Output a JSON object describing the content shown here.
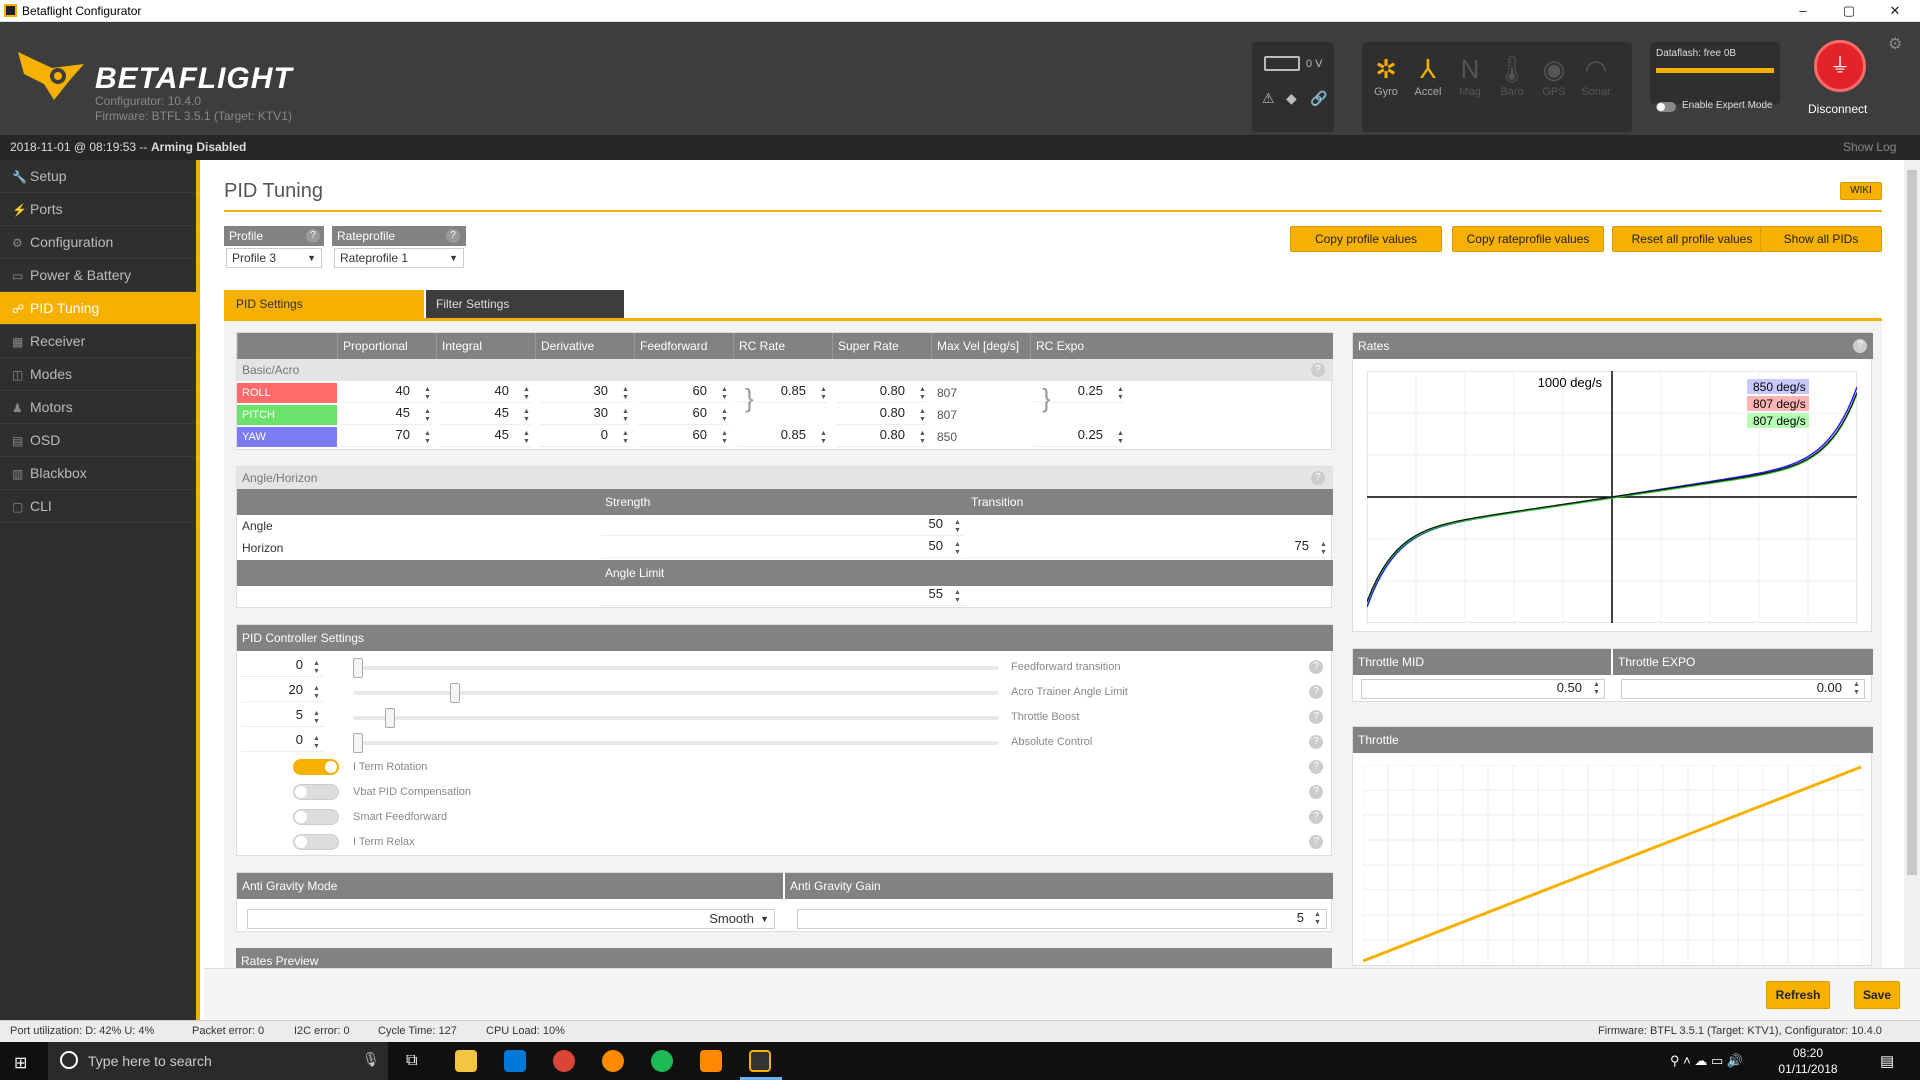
{
  "window": {
    "title": "Betaflight Configurator",
    "min": "–",
    "max": "▢",
    "close": "✕"
  },
  "header": {
    "logo_text": "BETAFLIGHT",
    "configurator_version": "Configurator: 10.4.0",
    "firmware_version": "Firmware: BTFL 3.5.1 (Target: KTV1)",
    "battery_voltage": "0 V",
    "sensors": [
      {
        "label": "Gyro",
        "active": true,
        "icon": "gyro-icon"
      },
      {
        "label": "Accel",
        "active": true,
        "icon": "accel-icon"
      },
      {
        "label": "Mag",
        "active": false,
        "icon": "mag-icon"
      },
      {
        "label": "Baro",
        "active": false,
        "icon": "baro-icon"
      },
      {
        "label": "GPS",
        "active": false,
        "icon": "gps-icon"
      },
      {
        "label": "Sonar",
        "active": false,
        "icon": "sonar-icon"
      }
    ],
    "dataflash": "Dataflash: free 0B",
    "expert_mode_label": "Enable Expert Mode",
    "disconnect_label": "Disconnect"
  },
  "statusline": {
    "datetime": "2018-11-01 @ 08:19:53 --",
    "arming": "Arming Disabled",
    "show_log": "Show Log"
  },
  "sidebar": {
    "items": [
      {
        "label": "Setup",
        "icon": "wrench-icon",
        "glyph": "🔧"
      },
      {
        "label": "Ports",
        "icon": "plug-icon",
        "glyph": "⚡"
      },
      {
        "label": "Configuration",
        "icon": "gear-icon",
        "glyph": "⚙"
      },
      {
        "label": "Power & Battery",
        "icon": "battery-icon",
        "glyph": "▭"
      },
      {
        "label": "PID Tuning",
        "icon": "pid-icon",
        "glyph": "☍",
        "active": true
      },
      {
        "label": "Receiver",
        "icon": "receiver-icon",
        "glyph": "▦"
      },
      {
        "label": "Modes",
        "icon": "modes-icon",
        "glyph": "◫"
      },
      {
        "label": "Motors",
        "icon": "motor-icon",
        "glyph": "♟"
      },
      {
        "label": "OSD",
        "icon": "osd-icon",
        "glyph": "▤"
      },
      {
        "label": "Blackbox",
        "icon": "blackbox-icon",
        "glyph": "▥"
      },
      {
        "label": "CLI",
        "icon": "cli-icon",
        "glyph": "▢"
      }
    ]
  },
  "page": {
    "title": "PID Tuning",
    "wiki": "WIKI",
    "profile_label": "Profile",
    "profile_value": "Profile 3",
    "rateprofile_label": "Rateprofile",
    "rateprofile_value": "Rateprofile 1",
    "buttons": {
      "copy_profile": "Copy profile values",
      "copy_rateprofile": "Copy rateprofile values",
      "reset_all": "Reset all profile values",
      "show_all": "Show all PIDs"
    },
    "tabs": {
      "pid": "PID Settings",
      "filter": "Filter Settings"
    }
  },
  "pid_table": {
    "headers": [
      "",
      "Proportional",
      "Integral",
      "Derivative",
      "Feedforward",
      "RC Rate",
      "Super Rate",
      "Max Vel [deg/s]",
      "RC Expo"
    ],
    "section": "Basic/Acro",
    "rows": [
      {
        "axis": "ROLL",
        "color": "#ff6b6b",
        "p": "40",
        "i": "40",
        "d": "30",
        "ff": "60",
        "rc_rate": "0.85",
        "super_rate": "0.80",
        "max_vel": "807",
        "expo": "0.25"
      },
      {
        "axis": "PITCH",
        "color": "#6be36b",
        "p": "45",
        "i": "45",
        "d": "30",
        "ff": "60",
        "rc_rate": "",
        "super_rate": "0.80",
        "max_vel": "807",
        "expo": ""
      },
      {
        "axis": "YAW",
        "color": "#7b7bf5",
        "p": "70",
        "i": "45",
        "d": "0",
        "ff": "60",
        "rc_rate": "0.85",
        "super_rate": "0.80",
        "max_vel": "850",
        "expo": "0.25"
      }
    ]
  },
  "angle_horizon": {
    "section": "Angle/Horizon",
    "strength_label": "Strength",
    "transition_label": "Transition",
    "angle_label": "Angle",
    "angle_strength": "50",
    "horizon_label": "Horizon",
    "horizon_strength": "50",
    "horizon_transition": "75",
    "angle_limit_label": "Angle Limit",
    "angle_limit": "55"
  },
  "controller": {
    "title": "PID Controller Settings",
    "sliders": [
      {
        "value": "0",
        "label": "Feedforward transition",
        "fraction": 0.0
      },
      {
        "value": "20",
        "label": "Acro Trainer Angle Limit",
        "fraction": 0.15
      },
      {
        "value": "5",
        "label": "Throttle Boost",
        "fraction": 0.05
      },
      {
        "value": "0",
        "label": "Absolute Control",
        "fraction": 0.0
      }
    ],
    "toggles": [
      {
        "label": "I Term Rotation",
        "on": true
      },
      {
        "label": "Vbat PID Compensation",
        "on": false
      },
      {
        "label": "Smart Feedforward",
        "on": false
      },
      {
        "label": "I Term Relax",
        "on": false
      }
    ]
  },
  "anti_gravity": {
    "mode_label": "Anti Gravity Mode",
    "mode_value": "Smooth",
    "gain_label": "Anti Gravity Gain",
    "gain_value": "5"
  },
  "rates_preview_label": "Rates Preview",
  "rates_panel": {
    "title": "Rates",
    "axis_label": "1000 deg/s",
    "legend": [
      {
        "text": "850 deg/s",
        "color": "#c8c8ff"
      },
      {
        "text": "807 deg/s",
        "color": "#ffb4b4"
      },
      {
        "text": "807 deg/s",
        "color": "#b4ffb4"
      }
    ]
  },
  "throttle_settings": {
    "mid_label": "Throttle MID",
    "mid_value": "0.50",
    "expo_label": "Throttle EXPO",
    "expo_value": "0.00"
  },
  "throttle_panel": {
    "title": "Throttle"
  },
  "footer": {
    "refresh": "Refresh",
    "save": "Save"
  },
  "statusbar": {
    "port": "Port utilization: D: 42% U: 4%",
    "packet": "Packet error: 0",
    "i2c": "I2C error: 0",
    "cycle": "Cycle Time: 127",
    "cpu": "CPU Load: 10%",
    "firmware": "Firmware: BTFL 3.5.1 (Target: KTV1), Configurator: 10.4.0"
  },
  "taskbar": {
    "search_placeholder": "Type here to search",
    "time": "08:20",
    "date": "01/11/2018"
  },
  "colors": {
    "accent": "#f5b000",
    "dark": "#3d3d3d",
    "sidebar": "#2f2f2f"
  }
}
